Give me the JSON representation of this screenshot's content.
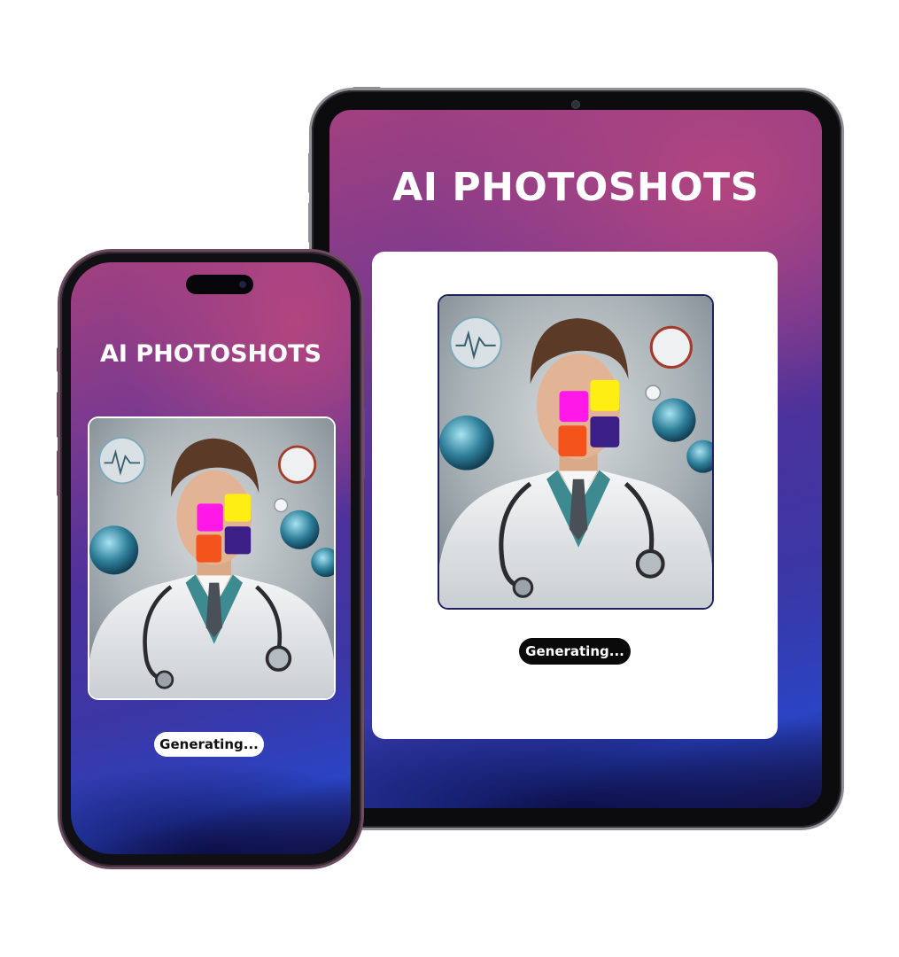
{
  "app": {
    "title": "AI PHOTOSHOTS",
    "status": "Generating..."
  },
  "colors": {
    "face_block_1": "#ff18e8",
    "face_block_2": "#ffee14",
    "face_block_3": "#f4541c",
    "face_block_4": "#3b1f86",
    "tablet_frame": "#8f8f95",
    "phone_frame": "#6d4d62"
  },
  "icons": {
    "photo": "doctor-portrait-placeholder"
  }
}
